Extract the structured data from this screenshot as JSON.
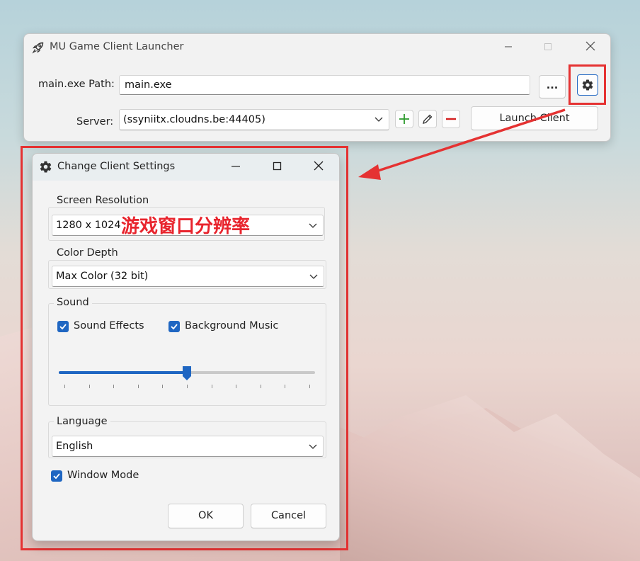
{
  "main_window": {
    "title": "MU Game Client Launcher",
    "path_label": "main.exe Path:",
    "path_value": "main.exe",
    "browse_label": "...",
    "server_label": "Server:",
    "server_value": "(ssyniitx.cloudns.be:44405)",
    "launch_label": "Launch Client"
  },
  "dialog": {
    "title": "Change Client Settings",
    "resolution": {
      "title": "Screen Resolution",
      "value": "1280 x 1024"
    },
    "color_depth": {
      "title": "Color Depth",
      "value": "Max Color (32 bit)"
    },
    "sound": {
      "title": "Sound",
      "effects_label": "Sound Effects",
      "effects_checked": true,
      "music_label": "Background Music",
      "music_checked": true,
      "volume": 0.5,
      "tick_count": 11
    },
    "language": {
      "title": "Language",
      "value": "English"
    },
    "window_mode": {
      "label": "Window Mode",
      "checked": true
    },
    "ok_label": "OK",
    "cancel_label": "Cancel"
  },
  "annotation": {
    "text": "游戏窗口分辨率",
    "color": "#e8242d"
  },
  "colors": {
    "accent": "#1f66c2",
    "highlight": "#e53232",
    "add": "#2e9a2e",
    "remove": "#d42020"
  }
}
